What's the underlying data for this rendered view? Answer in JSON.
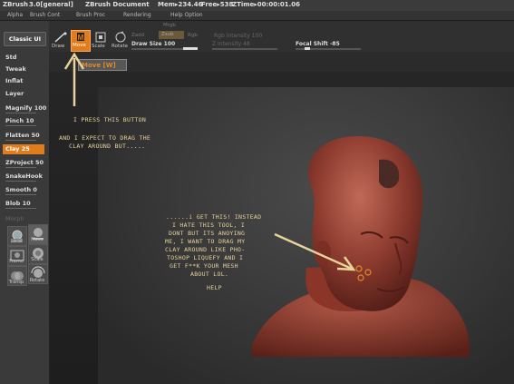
{
  "titlebar": {
    "app_name": "ZBrush",
    "version": "3.0[general]",
    "document": "ZBrush Document",
    "mem": "Mem▸234.46",
    "free": "Free▸538",
    "ztime": "ZTime▸00:00:01.06"
  },
  "menu": [
    "Alpha",
    "Brush Cont",
    "Brush Proc",
    "Rendering",
    "Help Option"
  ],
  "classic_button": "Classic UI",
  "brushes": [
    {
      "label": "Std",
      "value": ""
    },
    {
      "label": "Tweak",
      "value": ""
    },
    {
      "label": "Inflat",
      "value": ""
    },
    {
      "label": "Layer",
      "value": ""
    },
    {
      "label": "Magnify",
      "value": "100"
    },
    {
      "label": "Pinch",
      "value": "10"
    },
    {
      "label": "Flatten",
      "value": "50"
    },
    {
      "label": "Clay",
      "value": "25"
    },
    {
      "label": "ZProject",
      "value": "50"
    },
    {
      "label": "SnakeHook",
      "value": ""
    },
    {
      "label": "Smooth",
      "value": "0"
    },
    {
      "label": "Blob",
      "value": "10"
    }
  ],
  "morph_label": "Morph",
  "transform_buttons": [
    "Local",
    "Move",
    "Frame",
    "Scale",
    "Transp",
    "Rotate"
  ],
  "toolbar": {
    "draw": "Draw",
    "move": "Move",
    "scale": "Scale",
    "rotate": "Rotate",
    "zadd": "Zadd",
    "zsub": "Zsub",
    "rgb": "Rgb",
    "mrgb": "Mrgb",
    "draw_size": "Draw Size 100",
    "rgb_intensity": "Rgb Intensity 100",
    "z_intensity": "Z Intensity 48",
    "focal_shift": "Focal Shift -85"
  },
  "tooltip": "Move [W]",
  "annotations": {
    "press": "I PRESS THIS BUTTON",
    "expect_1": "AND I EXPECT TO DRAG THE",
    "expect_2": "CLAY AROUND BUT.....",
    "instead_1": "......i GET THIS! INSTEAD",
    "instead_2": "I HATE THIS TOOL, I",
    "instead_3": "DONT BUT ITS ANOYING",
    "instead_4": "ME, I WANT TO DRAG MY",
    "instead_5": "CLAY AROUND LIKE PHO-",
    "instead_6": "TOSHOP LIQUEFY AND I",
    "instead_7": "GET F**K YOUR MESH",
    "instead_8": "ABOUT LOL.",
    "help": "HELP"
  },
  "colors": {
    "accent": "#e07c1c",
    "annotation": "#e8d39a",
    "sculpt": "#a84a3c"
  }
}
